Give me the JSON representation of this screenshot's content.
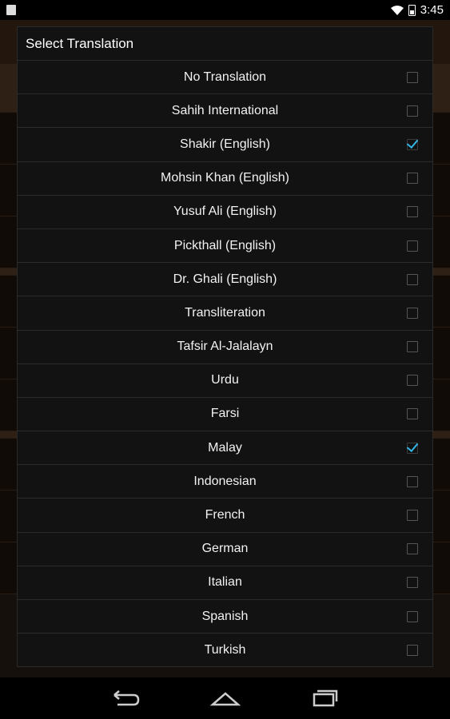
{
  "status_bar": {
    "time": "3:45"
  },
  "dialog": {
    "title": "Select Translation",
    "options": [
      {
        "label": "No Translation",
        "checked": false
      },
      {
        "label": "Sahih International",
        "checked": false
      },
      {
        "label": "Shakir (English)",
        "checked": true
      },
      {
        "label": "Mohsin Khan (English)",
        "checked": false
      },
      {
        "label": "Yusuf Ali (English)",
        "checked": false
      },
      {
        "label": "Pickthall (English)",
        "checked": false
      },
      {
        "label": "Dr. Ghali (English)",
        "checked": false
      },
      {
        "label": "Transliteration",
        "checked": false
      },
      {
        "label": "Tafsir Al-Jalalayn",
        "checked": false
      },
      {
        "label": "Urdu",
        "checked": false
      },
      {
        "label": "Farsi",
        "checked": false
      },
      {
        "label": "Malay",
        "checked": true
      },
      {
        "label": "Indonesian",
        "checked": false
      },
      {
        "label": "French",
        "checked": false
      },
      {
        "label": "German",
        "checked": false
      },
      {
        "label": "Italian",
        "checked": false
      },
      {
        "label": "Spanish",
        "checked": false
      },
      {
        "label": "Turkish",
        "checked": false
      }
    ]
  },
  "nav_bar": {
    "icons": [
      "back-icon",
      "home-icon",
      "recents-icon"
    ]
  },
  "colors": {
    "accent": "#33b5e5",
    "dialog_bg": "#121212",
    "divider": "#2c2c2c"
  }
}
